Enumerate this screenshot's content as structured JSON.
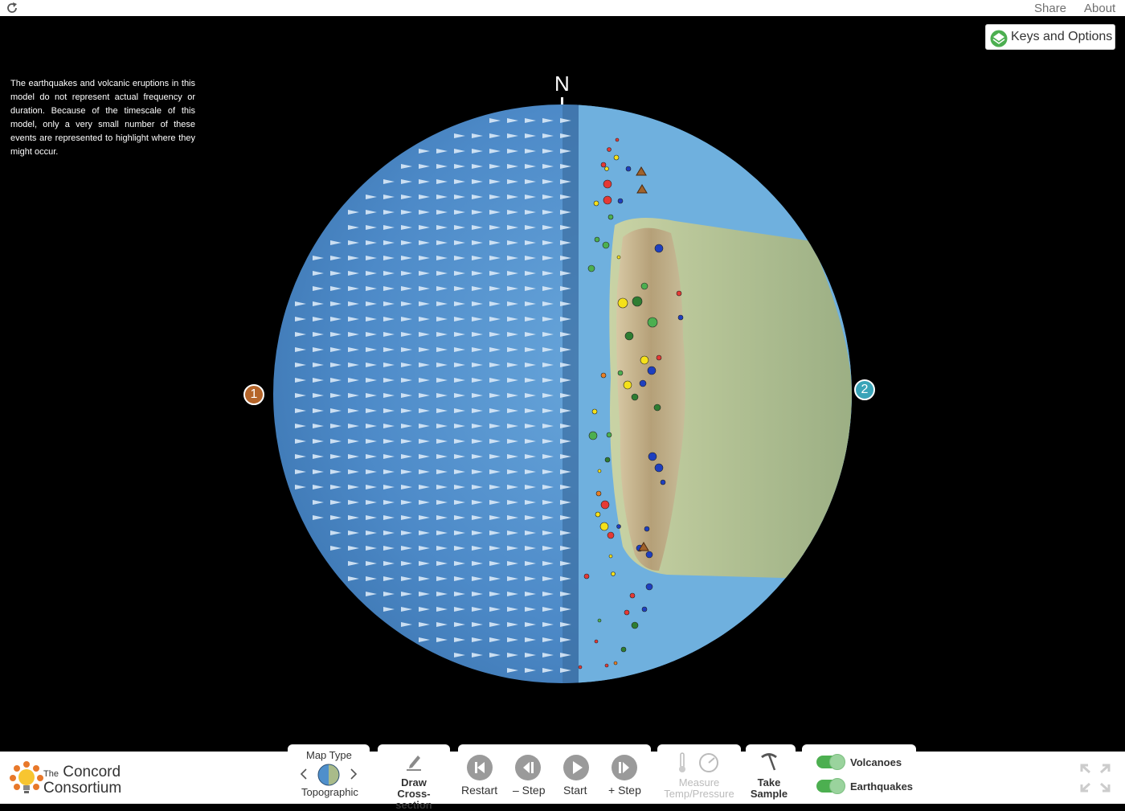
{
  "header": {
    "share": "Share",
    "about": "About"
  },
  "keys_options": {
    "label": "Keys and Options"
  },
  "disclaimer": "The earthquakes and volcanic eruptions in this model do not represent actual frequency or duration. Because of the timescale of this model, only a very small number of these events are represented to highlight where they might occur.",
  "globe": {
    "north": "N",
    "plate1": "1",
    "plate2": "2"
  },
  "colors": {
    "ocean": "#4f8fcb",
    "land": "#a9bb8a",
    "plate1": "#b5652a",
    "plate2": "#3aa4b8",
    "toggle": "#4caf50"
  },
  "logo": {
    "line1": "The",
    "line2": "Concord",
    "line3": "Consortium"
  },
  "toolbar": {
    "map_type_label": "Map Type",
    "map_type_value": "Topographic",
    "draw_label_1": "Draw",
    "draw_label_2": "Cross-section",
    "restart": "Restart",
    "step_back": "– Step",
    "start": "Start",
    "step_forward": "+ Step",
    "measure_1": "Measure",
    "measure_2": "Temp/Pressure",
    "take_1": "Take",
    "take_2": "Sample",
    "volcanoes": "Volcanoes",
    "earthquakes": "Earthquakes"
  }
}
